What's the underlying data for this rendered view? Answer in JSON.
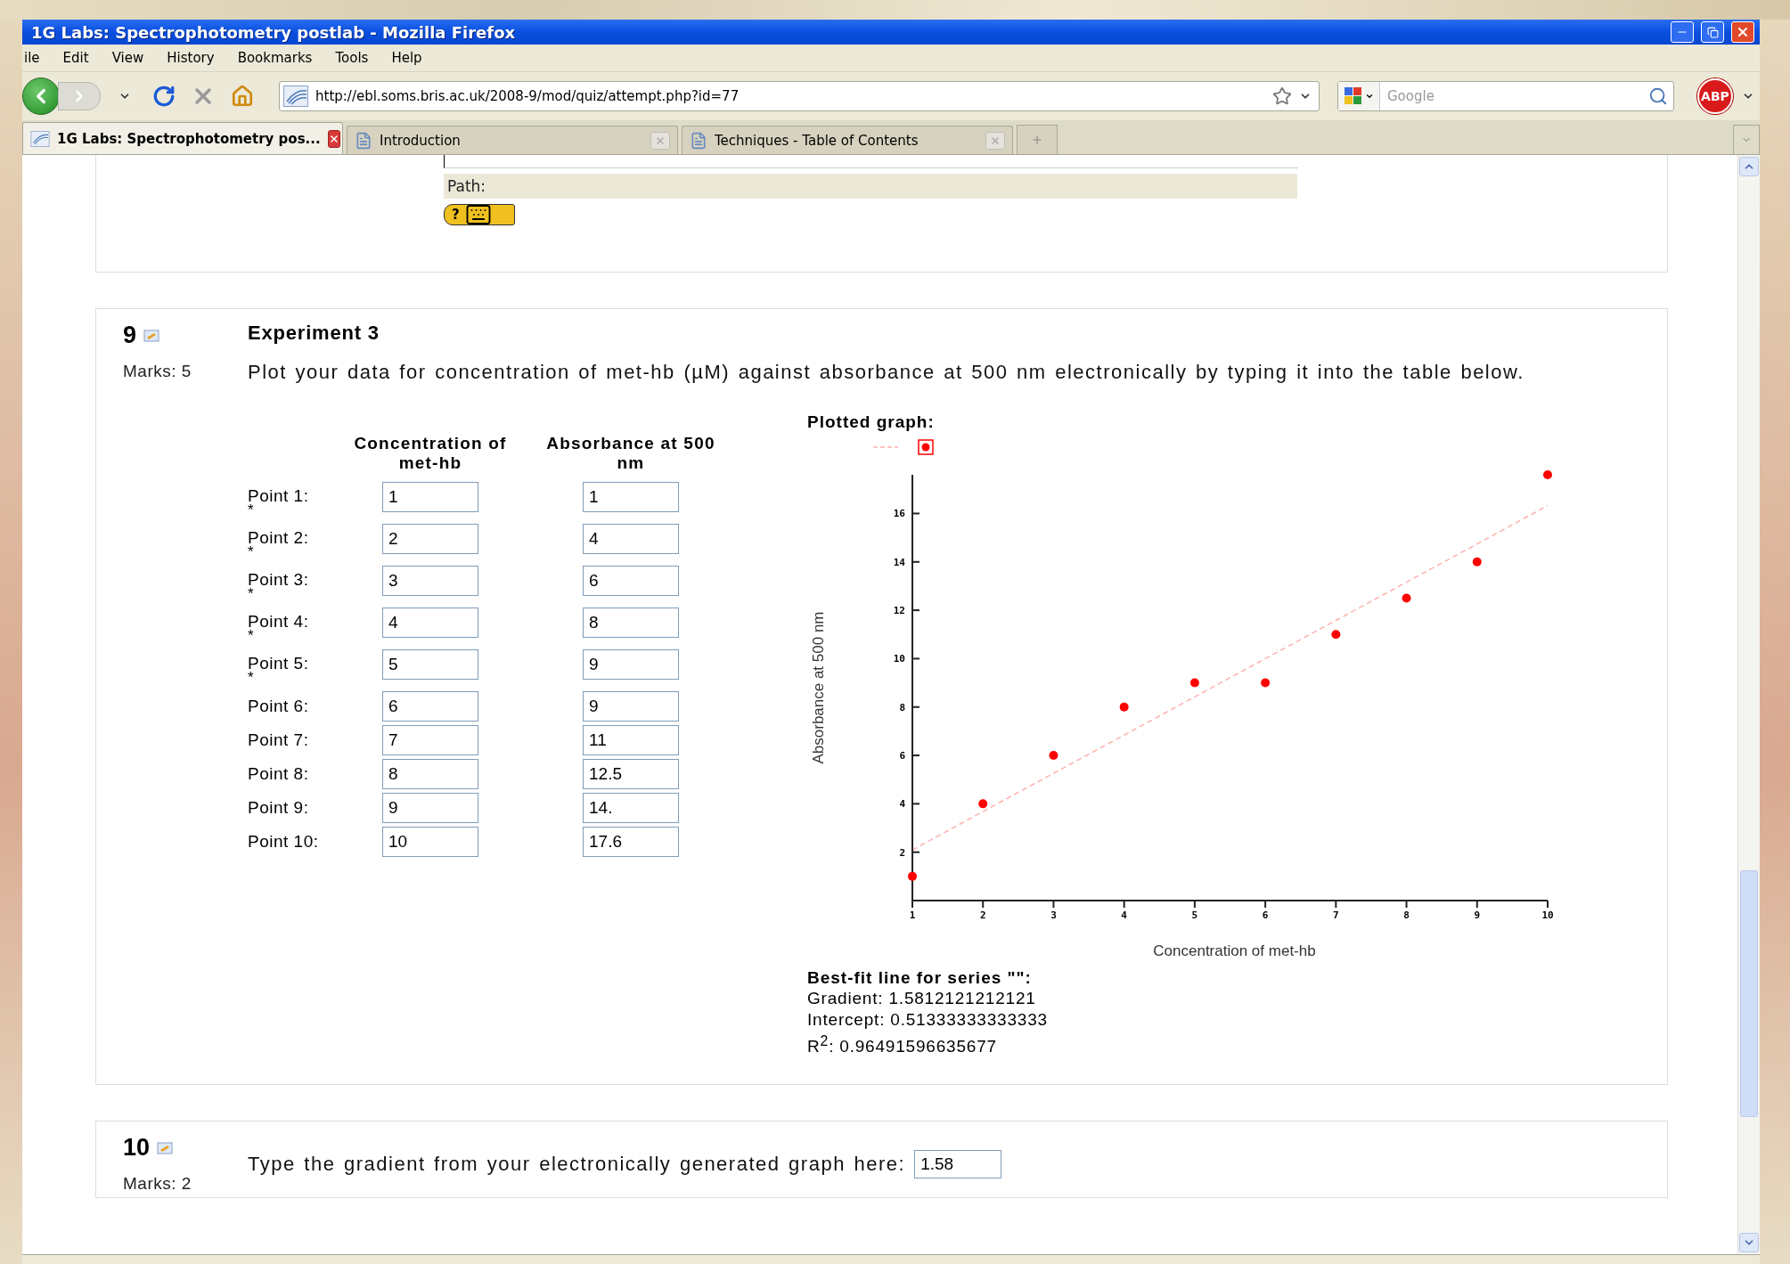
{
  "window": {
    "title": "1G Labs: Spectrophotometry postlab - Mozilla Firefox"
  },
  "menu": [
    "ile",
    "Edit",
    "View",
    "History",
    "Bookmarks",
    "Tools",
    "Help"
  ],
  "url": "http://ebl.soms.bris.ac.uk/2008-9/mod/quiz/attempt.php?id=77",
  "search": {
    "placeholder": "Google"
  },
  "adblock": "ABP",
  "tabs": [
    {
      "label": "1G Labs: Spectrophotometry pos...",
      "selected": true
    },
    {
      "label": "Introduction",
      "selected": false
    },
    {
      "label": "Techniques - Table of Contents",
      "selected": false
    }
  ],
  "editor": {
    "path_label": "Path:",
    "help_button": "?"
  },
  "questions": [
    {
      "kind": "plot",
      "number": "9",
      "marks": "Marks: 5",
      "title": "Experiment 3",
      "text": "Plot your data for concentration of met-hb (µM) against absorbance at 500 nm electronically by typing it into the table below.",
      "table": {
        "columns": [
          "Concentration of met-hb",
          "Absorbance at 500 nm"
        ],
        "rows": [
          {
            "label": "Point 1:",
            "mark": "*",
            "concentration": "1",
            "absorbance": "1"
          },
          {
            "label": "Point 2:",
            "mark": "*",
            "concentration": "2",
            "absorbance": "4"
          },
          {
            "label": "Point 3:",
            "mark": "*",
            "concentration": "3",
            "absorbance": "6"
          },
          {
            "label": "Point 4:",
            "mark": "*",
            "concentration": "4",
            "absorbance": "8"
          },
          {
            "label": "Point 5:",
            "mark": "*",
            "concentration": "5",
            "absorbance": "9"
          },
          {
            "label": "Point 6:",
            "concentration": "6",
            "absorbance": "9"
          },
          {
            "label": "Point 7:",
            "concentration": "7",
            "absorbance": "11"
          },
          {
            "label": "Point 8:",
            "concentration": "8",
            "absorbance": "12.5"
          },
          {
            "label": "Point 9:",
            "concentration": "9",
            "absorbance": "14."
          },
          {
            "label": "Point 10:",
            "concentration": "10",
            "absorbance": "17.6"
          }
        ]
      },
      "graph": {
        "title": "Plotted graph:",
        "chart_data": {
          "type": "scatter",
          "xlabel": "Concentration of met-hb",
          "ylabel": "Absorbance at 500 nm",
          "x": [
            1,
            2,
            3,
            4,
            5,
            6,
            7,
            8,
            9,
            10
          ],
          "series": [
            {
              "color": "#ff0000",
              "values": [
                1,
                4,
                6,
                8,
                9,
                9,
                11,
                12.5,
                14,
                17.6
              ]
            },
            {
              "type": "line",
              "line_style": "dashed",
              "color": "#ffb0b0",
              "values": [
                2.09,
                3.68,
                5.26,
                6.84,
                8.42,
                10,
                11.58,
                13.16,
                14.74,
                16.33
              ]
            }
          ],
          "xlim": [
            1,
            10
          ],
          "ylim": [
            0,
            17.6
          ],
          "xticks": [
            1,
            2,
            3,
            4,
            5,
            6,
            7,
            8,
            9,
            10
          ],
          "yticks": [
            2,
            4,
            6,
            8,
            10,
            12,
            14,
            16
          ]
        },
        "fit_title": "Best-fit line for series \"\":",
        "fit_lines": [
          "Gradient: 1.5812121212121",
          "Intercept: 0.51333333333333",
          "R$^{2}$: 0.96491596635677"
        ]
      }
    },
    {
      "kind": "short",
      "number": "10",
      "marks": "Marks: 2",
      "text": "Type the gradient from your electronically generated graph here:",
      "answer": "1.58"
    }
  ]
}
